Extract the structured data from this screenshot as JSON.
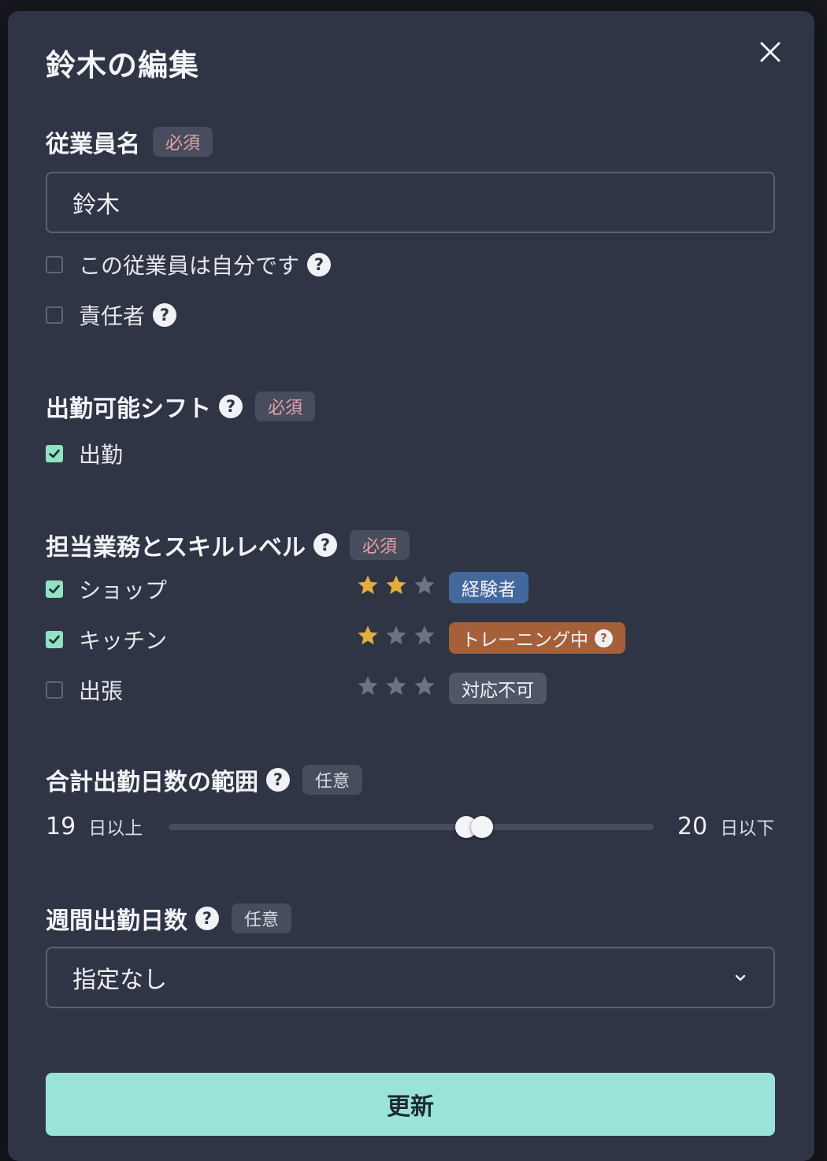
{
  "modal": {
    "title": "鈴木の編集",
    "close_icon": "close-icon"
  },
  "employee_name": {
    "label": "従業員名",
    "badge": "必須",
    "value": "鈴木",
    "placeholder": ""
  },
  "checkboxes": {
    "self": {
      "label": "この従業員は自分です",
      "checked": false
    },
    "manager": {
      "label": "責任者",
      "checked": false
    }
  },
  "shifts": {
    "label": "出勤可能シフト",
    "badge": "必須",
    "items": [
      {
        "label": "出勤",
        "checked": true
      }
    ]
  },
  "skills": {
    "label": "担当業務とスキルレベル",
    "badge": "必須",
    "items": [
      {
        "label": "ショップ",
        "checked": true,
        "stars": 2,
        "max_stars": 3,
        "level": "経験者"
      },
      {
        "label": "キッチン",
        "checked": true,
        "stars": 1,
        "max_stars": 3,
        "level": "トレーニング中"
      },
      {
        "label": "出張",
        "checked": false,
        "stars": 0,
        "max_stars": 3,
        "level": "対応不可"
      }
    ]
  },
  "workdays_range": {
    "label": "合計出勤日数の範囲",
    "badge": "任意",
    "min_value": "19",
    "min_unit": "日以上",
    "max_value": "20",
    "max_unit": "日以下"
  },
  "weekly_days": {
    "label": "週間出勤日数",
    "badge": "任意",
    "selected": "指定なし"
  },
  "submit": {
    "label": "更新"
  },
  "help_glyph": "?",
  "colors": {
    "modal_bg": "#2f3545",
    "accent": "#9ae4d7",
    "checkbox_on": "#8fe3c2",
    "star_on": "#e3ad3f",
    "star_off": "#6b7386",
    "required_text": "#e8a0a8",
    "level_experienced": "#43689c",
    "level_training": "#a5603a",
    "level_unavailable": "#4f5666"
  }
}
